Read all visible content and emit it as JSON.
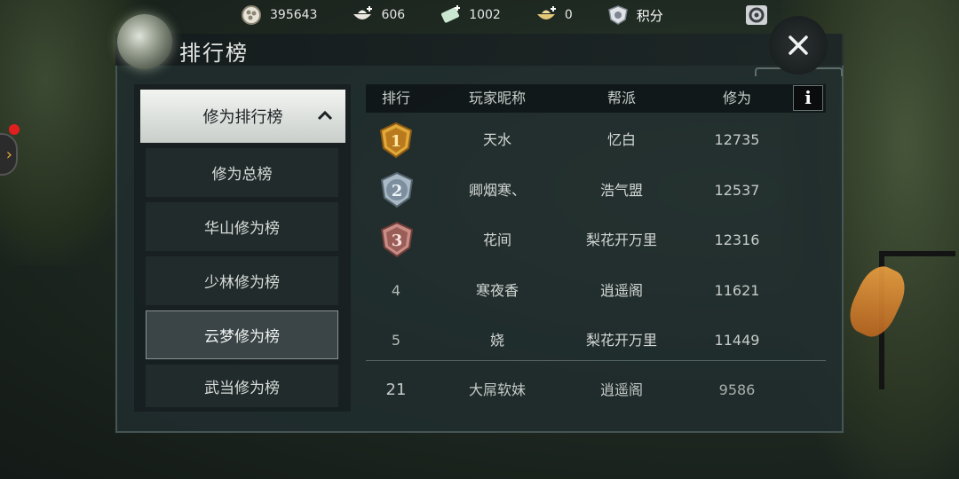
{
  "resources": [
    {
      "icon": "coin-purse-icon",
      "value": "395643"
    },
    {
      "icon": "ingot-bowl-icon",
      "value": "606"
    },
    {
      "icon": "jade-ticket-icon",
      "value": "1002"
    },
    {
      "icon": "gold-ingot-icon",
      "value": "0"
    },
    {
      "icon": "shield-emblem-icon",
      "value": "积分"
    }
  ],
  "panel": {
    "title": "排行榜"
  },
  "menu": {
    "header": "修为排行榜",
    "items": [
      "修为总榜",
      "华山修为榜",
      "少林修为榜",
      "云梦修为榜",
      "武当修为榜"
    ],
    "selected": "云梦修为榜"
  },
  "table": {
    "columns": [
      "排行",
      "玩家昵称",
      "帮派",
      "修为"
    ],
    "info_label": "i",
    "rows": [
      {
        "rank": "1",
        "name": "天水",
        "guild": "忆白",
        "score": "12735"
      },
      {
        "rank": "2",
        "name": "卿烟寒、",
        "guild": "浩气盟",
        "score": "12537"
      },
      {
        "rank": "3",
        "name": "花间",
        "guild": "梨花开万里",
        "score": "12316"
      },
      {
        "rank": "4",
        "name": "寒夜香",
        "guild": "逍遥阁",
        "score": "11621"
      },
      {
        "rank": "5",
        "name": "娆",
        "guild": "梨花开万里",
        "score": "11449"
      }
    ],
    "self": {
      "rank": "21",
      "name": "大屌软妹",
      "guild": "逍遥阁",
      "score": "9586"
    }
  },
  "colors": {
    "gold": "#e0a93a",
    "silver": "#a9b9c6",
    "bronze": "#c98d86",
    "panel": "#212d2e"
  }
}
